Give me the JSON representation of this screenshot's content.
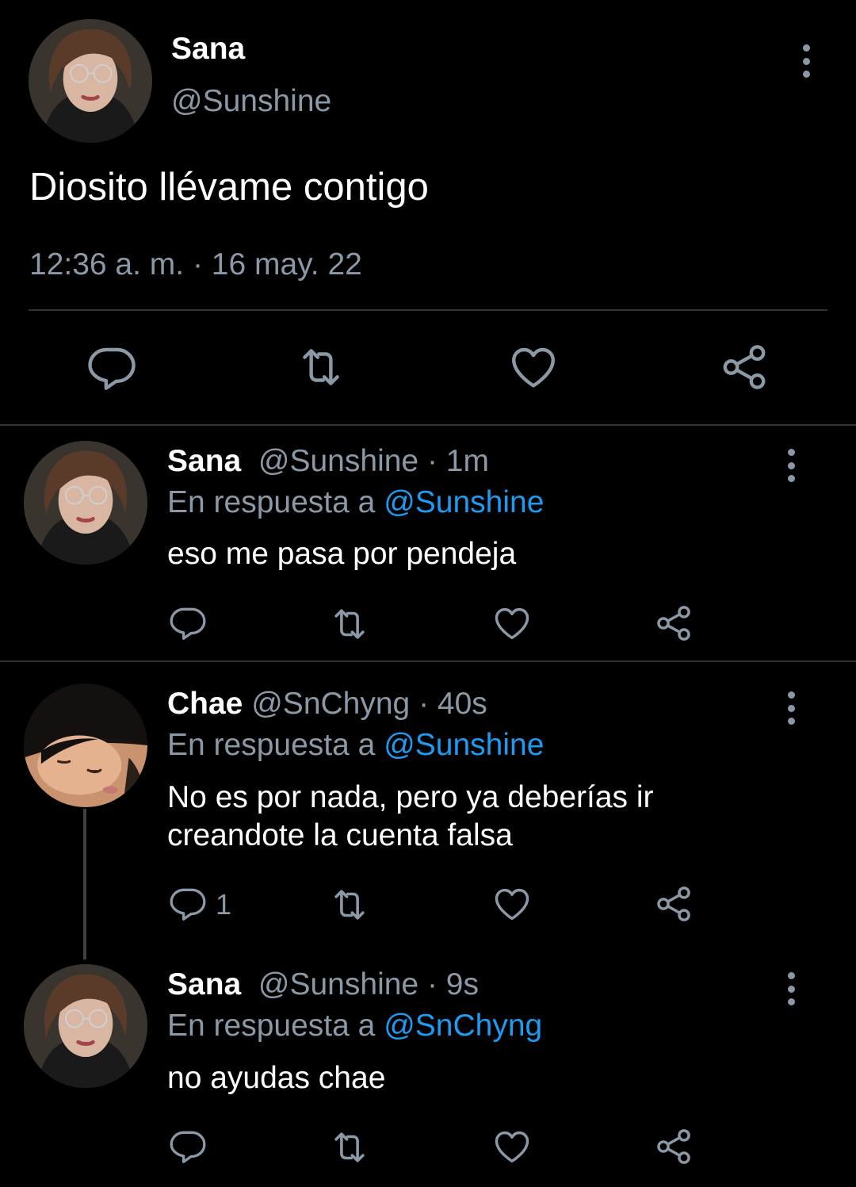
{
  "main_tweet": {
    "author_name": "Sana",
    "author_handle": "@Sunshine",
    "text": "Diosito llévame contigo",
    "timestamp": "12:36 a. m. · 16 may. 22"
  },
  "replies": [
    {
      "author_name": "Sana",
      "author_handle": "@Sunshine · 1m",
      "reply_prefix": "En respuesta a",
      "reply_to": "@Sunshine",
      "text_line1": "eso me pasa por pendeja",
      "text_line2": "",
      "reply_count": ""
    },
    {
      "author_name": "Chae",
      "author_handle": "@SnChyng · 40s",
      "reply_prefix": "En respuesta a",
      "reply_to": "@Sunshine",
      "text_line1": "No es por nada, pero ya deberías ir",
      "text_line2": "creandote la cuenta falsa",
      "reply_count": "1"
    },
    {
      "author_name": "Sana",
      "author_handle": "@Sunshine · 9s",
      "reply_prefix": "En respuesta a",
      "reply_to": "@SnChyng",
      "text_line1": "no ayudas chae",
      "text_line2": "",
      "reply_count": ""
    }
  ],
  "icons": {
    "reply": "speech-bubble-icon",
    "retweet": "retweet-arrows-icon",
    "like": "heart-icon",
    "share": "share-nodes-icon",
    "more": "vertical-ellipsis-icon"
  },
  "colors": {
    "background": "#000000",
    "text": "#ffffff",
    "muted": "#8b98a5",
    "link": "#1d9bf0",
    "divider": "#2f3336"
  }
}
